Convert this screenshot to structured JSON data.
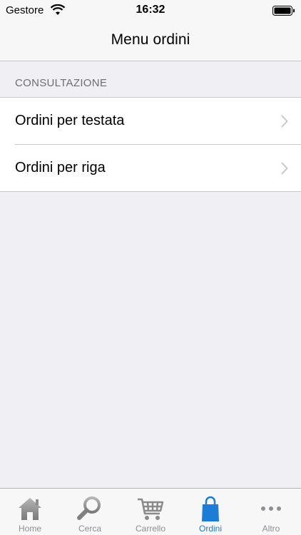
{
  "status_bar": {
    "carrier": "Gestore",
    "time": "16:32"
  },
  "nav": {
    "title": "Menu ordini"
  },
  "section": {
    "header": "CONSULTAZIONE",
    "items": [
      {
        "label": "Ordini per testata"
      },
      {
        "label": "Ordini per riga"
      }
    ]
  },
  "tabs": [
    {
      "label": "Home",
      "icon": "home-icon",
      "active": false
    },
    {
      "label": "Cerca",
      "icon": "search-icon",
      "active": false
    },
    {
      "label": "Carrello",
      "icon": "cart-icon",
      "active": false
    },
    {
      "label": "Ordini",
      "icon": "shopping-bag-icon",
      "active": true
    },
    {
      "label": "Altro",
      "icon": "more-icon",
      "active": false
    }
  ],
  "colors": {
    "accent": "#1c7cd6",
    "inactive": "#8e8e93",
    "background": "#efeff4"
  }
}
